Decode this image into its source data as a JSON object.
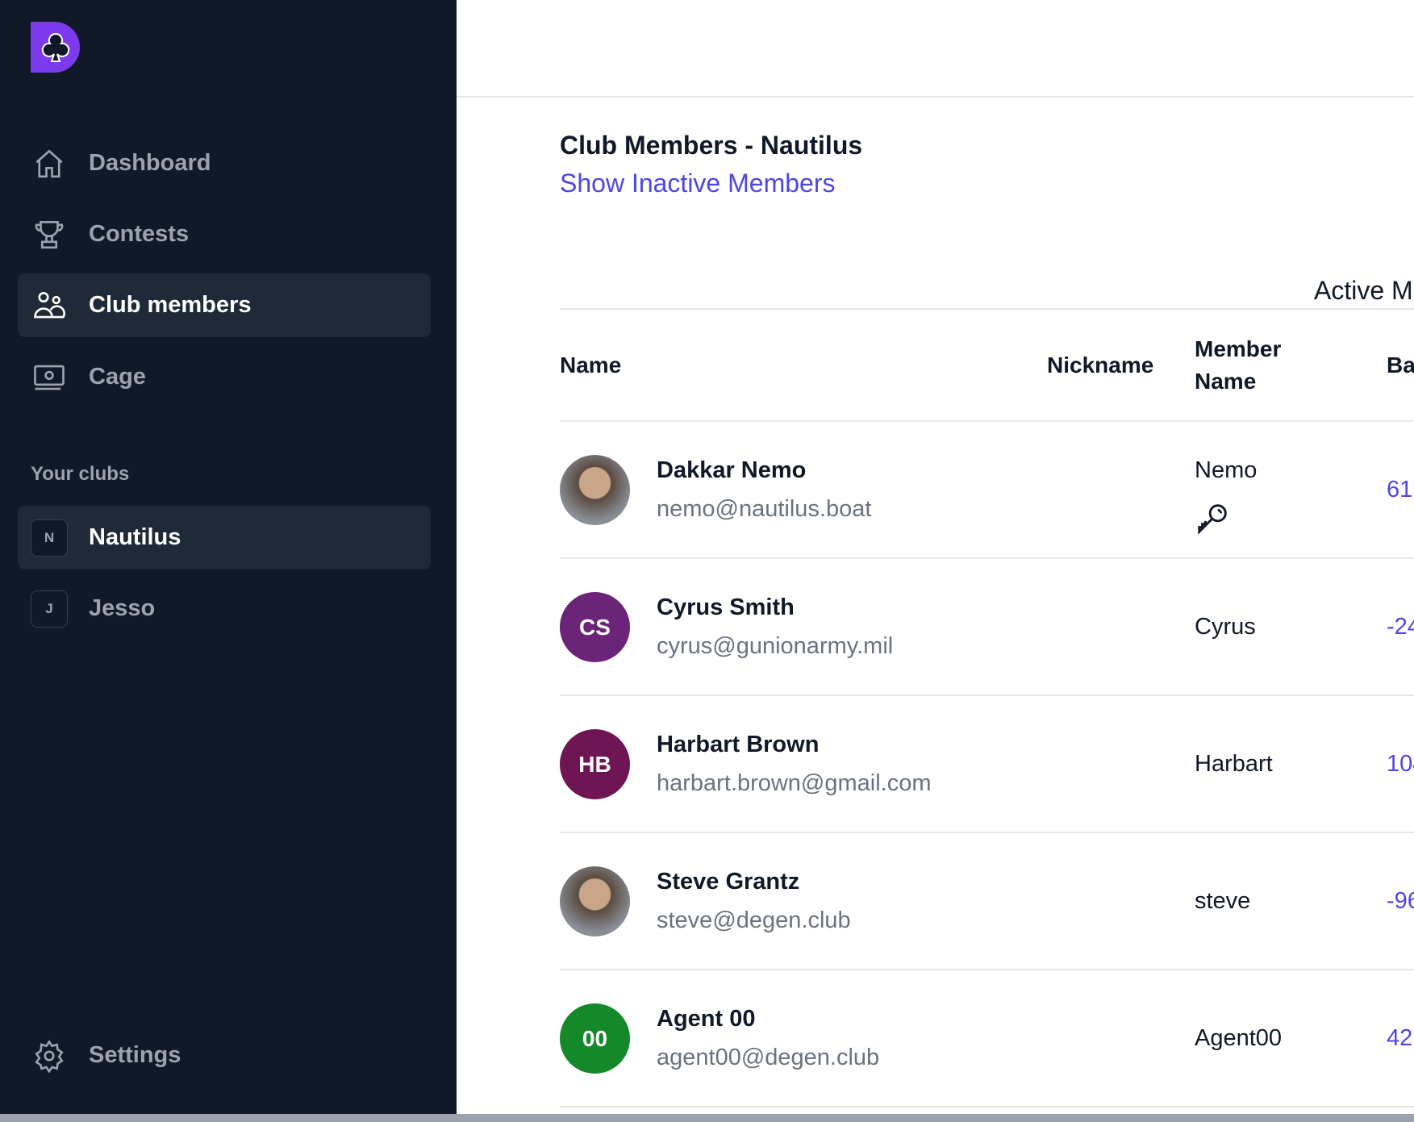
{
  "sidebar": {
    "nav": [
      {
        "label": "Dashboard",
        "icon": "home-icon"
      },
      {
        "label": "Contests",
        "icon": "trophy-icon"
      },
      {
        "label": "Club members",
        "icon": "users-icon",
        "active": true
      },
      {
        "label": "Cage",
        "icon": "cash-icon"
      }
    ],
    "clubs_heading": "Your clubs",
    "clubs": [
      {
        "initial": "N",
        "label": "Nautilus",
        "active": true
      },
      {
        "initial": "J",
        "label": "Jesso"
      }
    ],
    "settings": "Settings"
  },
  "main": {
    "title": "Club Members - Nautilus",
    "show_inactive": "Show Inactive Members",
    "tab": "Active M",
    "columns": [
      "Name",
      "Nickname",
      "Member\nName",
      "Ba"
    ],
    "rows": [
      {
        "name": "Dakkar Nemo",
        "email": "nemo@nautilus.boat",
        "nickname": "",
        "member_name": "Nemo",
        "balance": "61.",
        "avatar": "photo",
        "key_icon": true
      },
      {
        "name": "Cyrus Smith",
        "email": "cyrus@gunionarmy.mil",
        "nickname": "",
        "member_name": "Cyrus",
        "balance": "-24",
        "initials": "CS",
        "color": "#6b2478"
      },
      {
        "name": "Harbart Brown",
        "email": "harbart.brown@gmail.com",
        "nickname": "",
        "member_name": "Harbart",
        "balance": "104",
        "initials": "HB",
        "color": "#701554"
      },
      {
        "name": "Steve Grantz",
        "email": "steve@degen.club",
        "nickname": "",
        "member_name": "steve",
        "balance": "-96",
        "avatar": "photo"
      },
      {
        "name": "Agent 00",
        "email": "agent00@degen.club",
        "nickname": "",
        "member_name": "Agent00",
        "balance": "42",
        "initials": "00",
        "color": "#15892a"
      }
    ]
  },
  "colors": {
    "sidebar": "#111827",
    "accent": "#4f46e5",
    "logo": "#7c3aed"
  }
}
